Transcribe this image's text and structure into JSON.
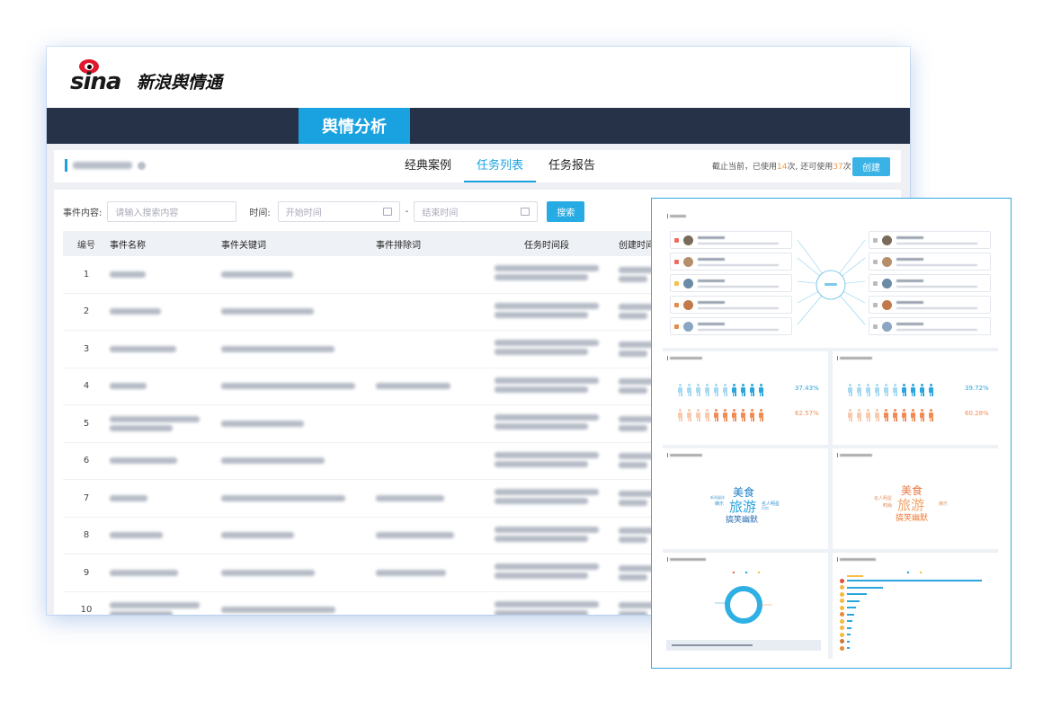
{
  "app": {
    "brand_latin": "sina",
    "brand_cn": "新浪舆情通"
  },
  "nav": {
    "active": "舆情分析"
  },
  "subheader": {
    "tabs": [
      {
        "label": "经典案例",
        "active": false
      },
      {
        "label": "任务列表",
        "active": true
      },
      {
        "label": "任务报告",
        "active": false
      }
    ],
    "usage_prefix": "截止当前，已使用",
    "usage_used": "14",
    "usage_mid": "次, 还可使用",
    "usage_left": "37",
    "usage_suffix": "次",
    "create_label": "创建"
  },
  "search": {
    "content_label": "事件内容:",
    "content_placeholder": "请输入搜索内容",
    "time_label": "时间:",
    "start_placeholder": "开始时间",
    "dash": "-",
    "end_placeholder": "结束时间",
    "button": "搜索"
  },
  "table": {
    "headers": [
      "编号",
      "事件名称",
      "事件关键词",
      "事件排除词",
      "任务时间段",
      "创建时间"
    ],
    "rows": [
      {
        "no": "1",
        "name_lines": 1,
        "kw": 1,
        "ex": 0
      },
      {
        "no": "2",
        "name_lines": 1,
        "kw": 1,
        "ex": 0
      },
      {
        "no": "3",
        "name_lines": 1,
        "kw": 1,
        "ex": 0
      },
      {
        "no": "4",
        "name_lines": 1,
        "kw": 1,
        "ex": 1
      },
      {
        "no": "5",
        "name_lines": 2,
        "kw": 1,
        "ex": 0
      },
      {
        "no": "6",
        "name_lines": 1,
        "kw": 1,
        "ex": 0
      },
      {
        "no": "7",
        "name_lines": 1,
        "kw": 1,
        "ex": 1
      },
      {
        "no": "8",
        "name_lines": 1,
        "kw": 1,
        "ex": 1
      },
      {
        "no": "9",
        "name_lines": 1,
        "kw": 1,
        "ex": 1
      },
      {
        "no": "10",
        "name_lines": 2,
        "kw": 1,
        "ex": 0
      }
    ]
  },
  "dashboard": {
    "blogger_percent": {
      "male": "37.43%",
      "female": "62.57%"
    },
    "commenter_percent": {
      "male": "39.72%",
      "female": "60.28%"
    },
    "wordcloud_left": [
      "美食",
      "旅游",
      "搞笑幽默",
      "新闻媒体",
      "娱乐",
      "名人明星",
      "时尚"
    ],
    "wordcloud_right": [
      "美食",
      "旅游",
      "搞笑幽默",
      "名人明星",
      "娱乐",
      "时尚"
    ],
    "colors": {
      "accent": "#1aa2e0",
      "male": "#2aa6dd",
      "female": "#f28c56",
      "nav": "#253248"
    }
  }
}
